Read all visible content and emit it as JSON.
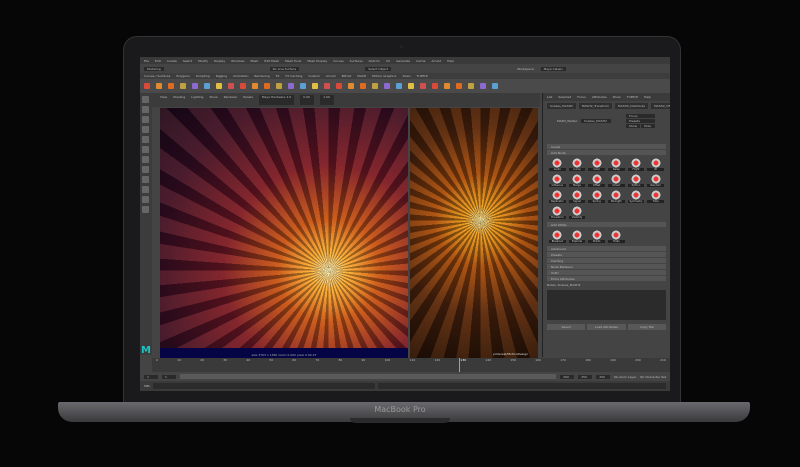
{
  "device": {
    "label": "MacBook Pro"
  },
  "maya": {
    "menubar": [
      "File",
      "Edit",
      "Create",
      "Select",
      "Modify",
      "Display",
      "Windows",
      "Mesh",
      "Edit Mesh",
      "Mesh Tools",
      "Mesh Display",
      "Curves",
      "Surfaces",
      "Deform",
      "UV",
      "Generate",
      "Cache",
      "Arnold",
      "Help"
    ],
    "workspace_label": "Workspace:",
    "workspace_value": "Maya Classic",
    "mode": "Modeling",
    "live_surface": "No Live Surface",
    "symmetry": "Select Object",
    "shelf_tabs": [
      "Curves / Surfaces",
      "Polygons",
      "Sculpting",
      "Rigging",
      "Animation",
      "Rendering",
      "FX",
      "FX Caching",
      "Custom",
      "Arnold",
      "Bifrost",
      "MASH",
      "Motion Graphics",
      "XGen",
      "TURTLE"
    ],
    "panel_menu": [
      "View",
      "Shading",
      "Lighting",
      "Show",
      "Renderer",
      "Panels"
    ],
    "renderer": "Maya Hardware 2.0",
    "exposure": "0.00",
    "gamma": "1.00",
    "viewport_caption": "size 3703 x 1380 zoom 0.000 pixel 0.00 47",
    "viewport2_caption": "pinterest/MotionDesign",
    "attr_menu": [
      "List",
      "Selected",
      "Focus",
      "Attributes",
      "Show",
      "TURTLE",
      "Help"
    ],
    "attr_tabs": [
      "Snakes_MASH2",
      "MASH2_Transform",
      "MASH2_Distribute",
      "MASH2_OF"
    ],
    "waiter_label": "MASH_Waiter:",
    "waiter_value": "Snakes_MASH2",
    "focus": "Focus",
    "presets": "Presets",
    "show": "Show",
    "hide": "Hide",
    "sections_top": [
      "Cauze",
      "Add Node"
    ],
    "nodes": [
      "Audio",
      "Curve",
      "Color",
      "Delay",
      "Flight",
      "ID",
      "Influence",
      "Merge",
      "Offset",
      "Orient",
      "Python",
      "Random",
      "Replicator",
      "Signal",
      "Spring",
      "Strength",
      "Symmetry",
      "Time",
      "Transform",
      "Visibility"
    ],
    "utility_section": "Add Utility",
    "utilities": [
      "Breakout",
      "Explode",
      "Points",
      "Trails"
    ],
    "sections": [
      "Advanced",
      "Presets",
      "Caching",
      "Node Behavior",
      "UUID",
      "Extra Attributes"
    ],
    "notes_label": "Notes: Snakes_MASH2",
    "buttons": [
      "Select",
      "Load Attributes",
      "Copy Tab"
    ],
    "timeline_ticks": [
      "0",
      "10",
      "20",
      "30",
      "40",
      "50",
      "60",
      "70",
      "80",
      "90",
      "100",
      "110",
      "120",
      "130",
      "140",
      "150",
      "160",
      "170",
      "180",
      "190",
      "200",
      "210"
    ],
    "current_frame": "130",
    "range": {
      "start": "1",
      "start2": "1",
      "end": "250",
      "end2": "250",
      "end3": "250",
      "frame": "1.00"
    },
    "anim_layer": "No Anim Layer",
    "char_set": "No Character Set",
    "cmd_label": "MEL"
  }
}
